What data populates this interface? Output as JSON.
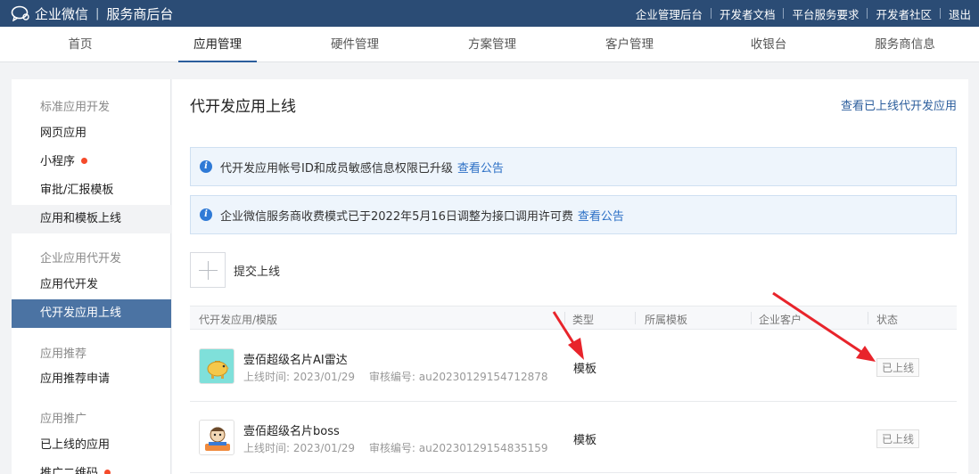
{
  "topbar": {
    "brand": "企业微信",
    "subtitle": "服务商后台",
    "links": [
      "企业管理后台",
      "开发者文档",
      "平台服务要求",
      "开发者社区",
      "退出"
    ]
  },
  "mainnav": {
    "items": [
      "首页",
      "应用管理",
      "硬件管理",
      "方案管理",
      "客户管理",
      "收银台",
      "服务商信息"
    ],
    "active": "应用管理"
  },
  "sidebar": {
    "groups": [
      {
        "title": "标准应用开发",
        "items": [
          "网页应用",
          "小程序",
          "审批/汇报模板",
          "应用和模板上线"
        ]
      },
      {
        "title": "企业应用代开发",
        "items": [
          "应用代开发",
          "代开发应用上线"
        ]
      },
      {
        "title": "应用推荐",
        "items": [
          "应用推荐申请"
        ]
      },
      {
        "title": "应用推广",
        "items": [
          "已上线的应用",
          "推广二维码"
        ]
      }
    ],
    "active_item": "代开发应用上线"
  },
  "page": {
    "title": "代开发应用上线",
    "top_link": "查看已上线代开发应用",
    "notices": [
      {
        "text": "代开发应用帐号ID和成员敏感信息权限已升级",
        "link": "查看公告"
      },
      {
        "text": "企业微信服务商收费模式已于2022年5月16日调整为接口调用许可费",
        "link": "查看公告"
      }
    ],
    "submit_label": "提交上线"
  },
  "table": {
    "columns": [
      "代开发应用/模版",
      "类型",
      "所属模板",
      "企业客户",
      "状态"
    ],
    "rows": [
      {
        "name": "壹佰超级名片AI雷达",
        "time_label": "上线时间:",
        "time": "2023/01/29",
        "audit_label": "审核编号:",
        "audit": "au20230129154712878",
        "type": "模板",
        "status": "已上线",
        "icon": "piggy-bank-icon"
      },
      {
        "name": "壹佰超级名片boss",
        "time_label": "上线时间:",
        "time": "2023/01/29",
        "audit_label": "审核编号:",
        "audit": "au20230129154835159",
        "type": "模板",
        "status": "已上线",
        "icon": "cartoon-mascot-icon"
      }
    ]
  },
  "colors": {
    "topbar": "#2b4c75",
    "active_nav": "#4b73a3",
    "link": "#2b6fc5",
    "arrow": "#e8242b",
    "badge_dot": "#f54a2a"
  }
}
